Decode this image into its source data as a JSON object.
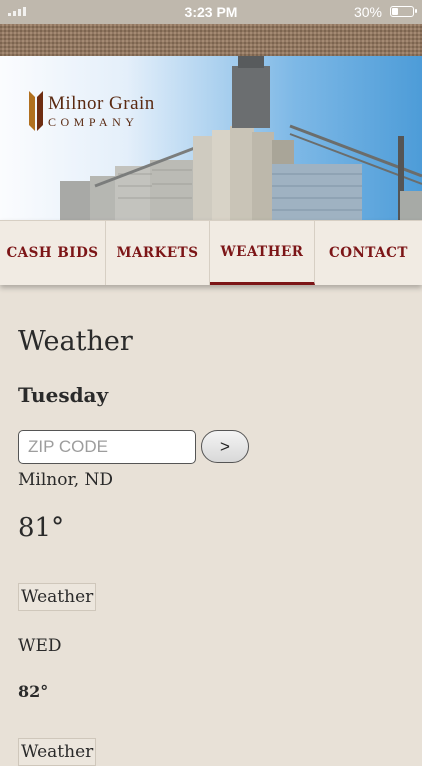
{
  "status_bar": {
    "time": "3:23 PM",
    "battery": "30%",
    "battery_level": 0.3
  },
  "brand": {
    "line1": "Milnor Grain",
    "line2": "Company"
  },
  "nav": {
    "items": [
      {
        "label": "CASH BIDS",
        "active": false
      },
      {
        "label": "MARKETS",
        "active": false
      },
      {
        "label": "WEATHER",
        "active": true
      },
      {
        "label": "CONTACT",
        "active": false
      }
    ]
  },
  "page": {
    "title": "Weather"
  },
  "current": {
    "day": "Tuesday",
    "zip_placeholder": "ZIP CODE",
    "zip_value": "",
    "go_label": ">",
    "location": "Milnor, ND",
    "temperature": "81°",
    "image_alt": "Weather"
  },
  "forecast": [
    {
      "day": "WED",
      "temperature": "82°",
      "image_alt": "Weather"
    }
  ],
  "colors": {
    "accent": "#7c1517",
    "background": "#e8e1d7",
    "nav_bg": "#f1ebe3"
  }
}
